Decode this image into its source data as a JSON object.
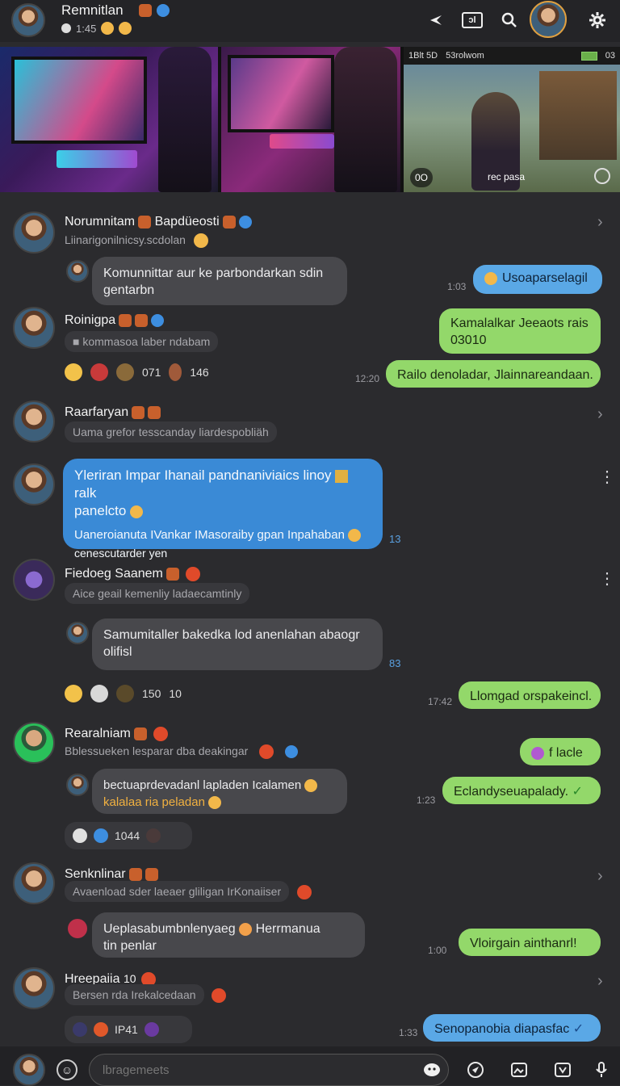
{
  "header": {
    "title": "Remnitlan",
    "status": "1:45",
    "icons": [
      "back-icon",
      "media-icon",
      "search-icon",
      "settings-icon"
    ],
    "media_label": "ɔl"
  },
  "gallery": {
    "status_time": "1Blt 5D",
    "status_carrier": "53rolwom",
    "status_battery": "03",
    "video_left": "0O",
    "video_center": "rec pasa"
  },
  "rows": [
    {
      "name": "Norumnitam",
      "name2": "Bapdüeosti",
      "preview": "Liinarigonilnicsy.scdolan",
      "bubble": "Komunnittar aur ke parbondarkan sdin gentarbn",
      "reply_time": "1:03",
      "reply": "Usoaparselagil"
    },
    {
      "name": "Roinigpa",
      "preview": "kommasoa laber ndabam",
      "reply_a": "Kamalalkar Jeeaots rais 03010",
      "reactions": [
        "071",
        "146"
      ],
      "time": "12:20",
      "reply_b": "Railo denoladar, Jlainnareandaan."
    },
    {
      "name": "Raarfaryan",
      "preview": "Uama grefor tesscanday liardespobliäh"
    },
    {
      "name": "",
      "blue_line1": "Yleriran Impar Ihanail pandnaniviaics linoy",
      "blue_line1b": "ralk",
      "blue_line2": "panelcto",
      "blue_line3": "Uaneroianuta IVankar IMasoraiby gpan Inpahaban",
      "blue_line4": "cenescutarder yen",
      "blue_time": "13"
    },
    {
      "name": "Fiedoeg Saanem",
      "preview": "Aice geail kemenliy ladaecamtinly",
      "bubble": "Samumitaller bakedka lod anenlahan abaogr olifisl",
      "bubble_time": "83",
      "reactions": [
        "150",
        "10"
      ],
      "time": "17:42",
      "reply": "Llomgad orspakeincl."
    },
    {
      "name": "Rearalniam",
      "preview": "Bblessueken lesparar dba deakingar",
      "reply_a": "f lacle",
      "bubble_line1": "bectuaprdevadanl lapladen Icalamen",
      "bubble_line2": "kalalaa ria peladan",
      "time": "1:23",
      "reply_b": "Eclandyseuapalady.",
      "reactions": [
        "1044"
      ]
    },
    {
      "name": "Senknlinar",
      "preview": "Avaenload sder laeaer gliligan IrKonaiiser",
      "bubble_line1": "Ueplasabumbnlenyaeg",
      "bubble_line1b": "Herrmanua",
      "bubble_line2": "tin penlar",
      "time": "1:00",
      "reply": "Vloirgain ainthanrl!"
    },
    {
      "name": "Hreepaiia",
      "name_extra": "10",
      "preview": "Bersen rda Irekalcedaan",
      "reactions": [
        "IP41"
      ],
      "time": "1:33",
      "reply": "Senopanobia diapasfac"
    }
  ],
  "composer": {
    "placeholder": "lbragemeets"
  },
  "colors": {
    "background": "#2b2b2e",
    "green_bubble": "#93d86a",
    "blue_bubble": "#3a8ad6",
    "light_blue_bubble": "#5aa8e6",
    "gray_bubble": "#48484c"
  }
}
